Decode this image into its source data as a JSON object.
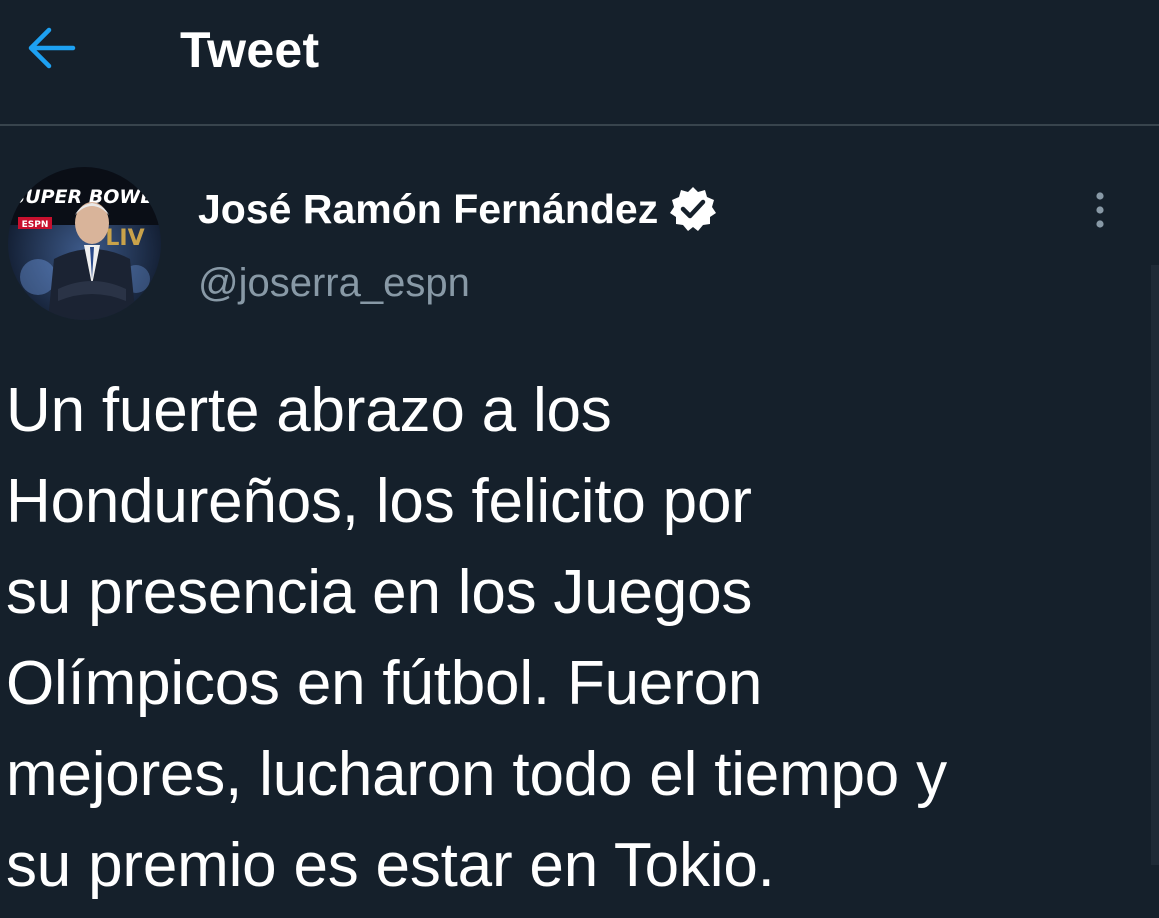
{
  "header": {
    "back_icon": "arrow-left-icon",
    "title": "Tweet"
  },
  "author": {
    "display_name": "José Ramón Fernández",
    "handle": "@joserra_espn",
    "verified": true,
    "avatar_icon": "avatar-image",
    "avatar_text": {
      "event": "SUPER BOWL",
      "edition": "LIV",
      "network": "ESPN"
    }
  },
  "more_icon": "more-vertical-icon",
  "tweet": {
    "lines": [
      "Un fuerte abrazo a los",
      "Hondureños, los felicito por",
      "su presencia en los Juegos",
      "Olímpicos en fútbol. Fueron",
      "mejores, lucharon todo el tiempo y",
      "su premio es estar en Tokio."
    ]
  },
  "colors": {
    "background": "#15202b",
    "accent": "#1da1f2",
    "secondary_text": "#8899a6",
    "divider": "#38444d"
  }
}
